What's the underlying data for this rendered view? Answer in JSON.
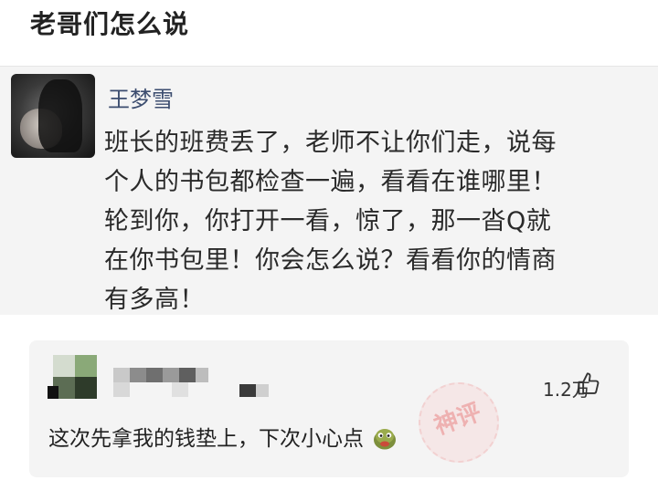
{
  "header": {
    "title": "老哥们怎么说"
  },
  "post": {
    "author": "王梦雪",
    "lines": [
      "班长的班费丢了，老师不让你们走，说每",
      "个人的书包都检查一遍，看看在谁哪里！",
      "轮到你，你打开一看，惊了，那一沓Q就",
      "在你书包里！你会怎么说？看看你的情商",
      "有多高！"
    ]
  },
  "comment": {
    "likes": "1.2万",
    "text": "这次先拿我的钱垫上，下次小心点",
    "stamp": "神评",
    "emoji": "turtle-face-emoji",
    "icons": {
      "like": "thumbs-up-icon"
    }
  },
  "colors": {
    "author": "#3c4d6f",
    "card_bg": "#f4f4f4",
    "stamp": "#e66e6e"
  }
}
